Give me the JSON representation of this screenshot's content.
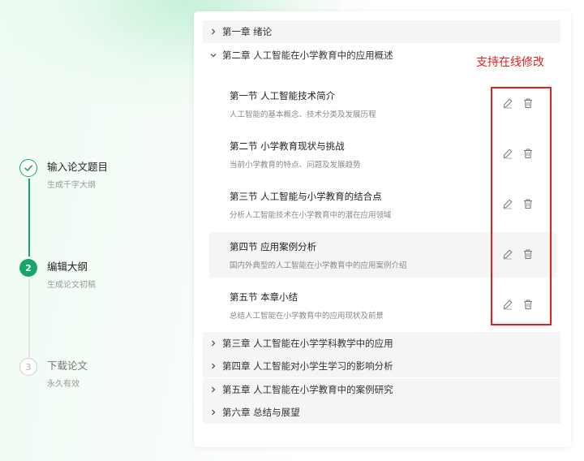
{
  "stepper": {
    "steps": [
      {
        "title": "输入论文题目",
        "subtitle": "生成千字大纲",
        "state": "done",
        "icon": "check-icon"
      },
      {
        "title": "编辑大纲",
        "subtitle": "生成论文初稿",
        "state": "active",
        "number": "2"
      },
      {
        "title": "下载论文",
        "subtitle": "永久有效",
        "state": "pending",
        "number": "3"
      }
    ]
  },
  "outline": {
    "chapters": [
      {
        "label": "第一章 绪论",
        "expanded": false
      },
      {
        "label": "第二章 人工智能在小学教育中的应用概述",
        "expanded": true
      },
      {
        "label": "第三章 人工智能在小学学科教学中的应用",
        "expanded": false
      },
      {
        "label": "第四章 人工智能对小学生学习的影响分析",
        "expanded": false
      },
      {
        "label": "第五章 人工智能在小学教育中的案例研究",
        "expanded": false
      },
      {
        "label": "第六章 总结与展望",
        "expanded": false
      }
    ],
    "sections": [
      {
        "title": "第一节 人工智能技术简介",
        "desc": "人工智能的基本概念、技术分类及发展历程"
      },
      {
        "title": "第二节 小学教育现状与挑战",
        "desc": "当前小学教育的特点、问题及发展趋势"
      },
      {
        "title": "第三节 人工智能与小学教育的结合点",
        "desc": "分析人工智能技术在小学教育中的潜在应用领域"
      },
      {
        "title": "第四节 应用案例分析",
        "desc": "国内外典型的人工智能在小学教育中的应用案例介绍"
      },
      {
        "title": "第五节 本章小结",
        "desc": "总结人工智能在小学教育中的应用现状及前景"
      }
    ],
    "action_icons": [
      "edit-icon",
      "delete-icon"
    ]
  },
  "annotation": {
    "text": "支持在线修改",
    "color": "#e02020"
  },
  "colors": {
    "accent": "#16a66a",
    "highlight": "#e02020"
  }
}
